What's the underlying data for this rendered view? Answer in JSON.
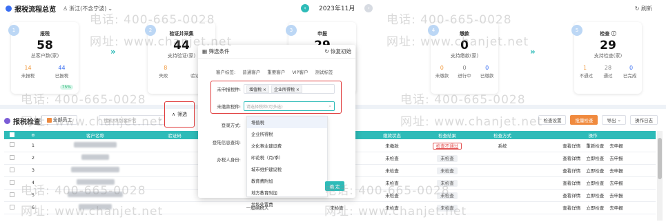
{
  "header": {
    "title": "报税流程总览",
    "region": "浙江(不含宁波)",
    "month": "2023年11月",
    "refresh": "刷新"
  },
  "flow": [
    {
      "n": "1",
      "title": "报税",
      "value": "58",
      "sub": "总客户数(家)",
      "c1": "14",
      "c2": "44",
      "l1": "未报税",
      "l2": "已报税",
      "pct": "75%"
    },
    {
      "n": "2",
      "title": "验证并采集",
      "value": "44",
      "sub": "支持验证(家)",
      "c1": "8",
      "c2": "",
      "l1": "失败",
      "l2": "验证中",
      "pct": ""
    },
    {
      "n": "3",
      "title": "申报",
      "value": "29",
      "sub": "",
      "c1": "",
      "c2": "",
      "l1": "",
      "l2": "",
      "pct": ""
    },
    {
      "n": "4",
      "title": "缴款",
      "value": "0",
      "sub": "支持缴款(家)",
      "c1": "0",
      "c2": "0",
      "c3": "0",
      "l1": "未缴款",
      "l2": "进行中",
      "l3": "已缴款",
      "pct": ""
    },
    {
      "n": "5",
      "title": "检查 ⓘ",
      "value": "29",
      "sub": "支持检查(家)",
      "c1": "1",
      "c2": "28",
      "c3": "0",
      "l1": "不通过",
      "l2": "通过",
      "l3": "已完成",
      "pct": ""
    }
  ],
  "section": {
    "title": "报税检查",
    "staff_btn": "全部员工",
    "search_placeholder": "搜索/识别客户名",
    "filter_btn": "筛选",
    "btn_check_settings": "检查设置",
    "btn_batch_check": "批量检查",
    "btn_export": "导出",
    "btn_log": "操作日志"
  },
  "table": {
    "headers": [
      "",
      "⊕",
      "客户名称",
      "验证码",
      "",
      "",
      "缴款状态",
      "检查结果",
      "检查方式",
      "操作"
    ],
    "rows": [
      {
        "idx": "1",
        "pay": "未缴款",
        "result": "检查不通过",
        "result_type": "red",
        "method": "系统",
        "ops": [
          "查看详情",
          "重新检查",
          "去申报"
        ]
      },
      {
        "idx": "2",
        "pay": "未检查",
        "result": "未检查",
        "result_type": "grey",
        "method": "",
        "ops": [
          "查看详情",
          "立即检查",
          "去申报"
        ]
      },
      {
        "idx": "3",
        "pay": "未检查",
        "result": "未检查",
        "result_type": "grey",
        "method": "",
        "ops": [
          "查看详情",
          "立即检查",
          "去申报"
        ]
      },
      {
        "idx": "4",
        "pay": "未检查",
        "result": "未检查",
        "result_type": "grey",
        "method": "",
        "ops": [
          "查看详情",
          "立即检查",
          "去申报"
        ]
      },
      {
        "idx": "5",
        "pay": "未检查",
        "result": "未检查",
        "result_type": "grey",
        "method": "",
        "ops": [
          "查看详情",
          "立即检查",
          "去申报"
        ]
      },
      {
        "idx": "6",
        "pay": "未检查",
        "result": "未检查",
        "result_type": "grey",
        "method": "",
        "ops": [
          "查看详情",
          "立即检查",
          "去申报"
        ],
        "extra": "一般纳税人",
        "extra2": "未检查"
      }
    ]
  },
  "popup": {
    "title": "筛选条件",
    "reset": "恢复初始",
    "tag_label": "客户标签:",
    "tags": [
      "普通客户",
      "重要客户",
      "VIP客户",
      "测试标签"
    ],
    "unreported_label": "未申报税种:",
    "chips": [
      "增值税",
      "企业所得税"
    ],
    "undeducted_label": "未缴款税种:",
    "undeducted_placeholder": "请选择税种(可多选)",
    "login_label": "登录方式:",
    "verify_label": "登陆信息查询:",
    "taxer_label": "办税人身份:",
    "options": [
      "增值税",
      "企业所得税",
      "文化事业建设费",
      "印花税（月/季）",
      "城市维护建设税",
      "教育费附加",
      "地方教育附加",
      "垃圾处置费"
    ],
    "ok": "确 定"
  },
  "watermark": {
    "phone": "电话: 400-665-0028",
    "site": "网址: www.chanjet.net"
  }
}
